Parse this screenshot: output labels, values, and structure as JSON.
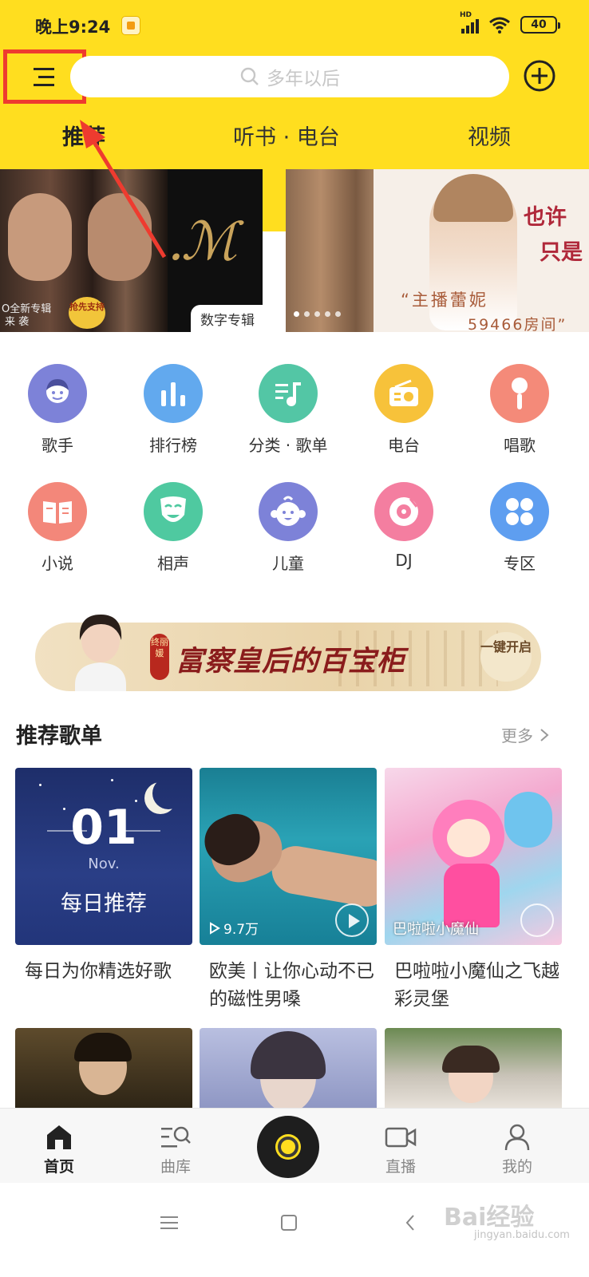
{
  "status_bar": {
    "time": "晚上9:24",
    "network": "HD",
    "battery": "40"
  },
  "header": {
    "menu_icon": "hamburger-icon",
    "search_placeholder": "多年以后",
    "add_icon": "plus-circle-icon",
    "tabs": [
      {
        "label": "推荐",
        "active": true
      },
      {
        "label": "听书 · 电台",
        "active": false
      },
      {
        "label": "视频",
        "active": false
      }
    ],
    "accent_color": "#ffde1f",
    "highlight_color": "#ee3b2f"
  },
  "banners": {
    "left": {
      "caption1": "O全新专辑",
      "caption2": "来 袭",
      "badge": "抢先支持",
      "tag": "数字专辑"
    },
    "right": {
      "headline1": "也许",
      "headline2": "只是",
      "host_line": "“主播蕾妮",
      "room_line": "59466房间”"
    },
    "page_count": 5,
    "current_page": 1
  },
  "categories": [
    {
      "label": "歌手",
      "icon": "singer-icon",
      "color": "#7d82d8"
    },
    {
      "label": "排行榜",
      "icon": "chart-icon",
      "color": "#62a9ee"
    },
    {
      "label": "分类 · 歌单",
      "icon": "playlist-icon",
      "color": "#53c6a5"
    },
    {
      "label": "电台",
      "icon": "radio-icon",
      "color": "#f7c23a"
    },
    {
      "label": "唱歌",
      "icon": "microphone-icon",
      "color": "#f48a79"
    },
    {
      "label": "小说",
      "icon": "book-icon",
      "color": "#f3877a"
    },
    {
      "label": "相声",
      "icon": "mask-icon",
      "color": "#4fc9a0"
    },
    {
      "label": "儿童",
      "icon": "child-icon",
      "color": "#7d82d8"
    },
    {
      "label": "DJ",
      "icon": "vinyl-icon",
      "color": "#f47ea0"
    },
    {
      "label": "专区",
      "icon": "grid-icon",
      "color": "#5e9ef0"
    }
  ],
  "promo": {
    "seal": "终丽媛",
    "title": "富察皇后的百宝柜",
    "cta": "一键开启"
  },
  "recommend": {
    "title": "推荐歌单",
    "more": "更多",
    "cards": [
      {
        "caption": "每日为你精选好歌",
        "day": "01",
        "month": "Nov.",
        "cover_text": "每日推荐"
      },
      {
        "caption": "欧美丨让你心动不已的磁性男嗓",
        "plays": "9.7万"
      },
      {
        "caption": "巴啦啦小魔仙之飞越彩灵堡",
        "cover_text": "巴啦啦小魔仙"
      }
    ]
  },
  "bottom_nav": [
    {
      "label": "首页",
      "icon": "home-icon",
      "active": true
    },
    {
      "label": "曲库",
      "icon": "library-search-icon",
      "active": false
    },
    {
      "label": "直播",
      "icon": "video-camera-icon",
      "active": false
    },
    {
      "label": "我的",
      "icon": "person-icon",
      "active": false
    }
  ],
  "watermark": {
    "brand": "Bai经验",
    "url": "jingyan.baidu.com"
  }
}
